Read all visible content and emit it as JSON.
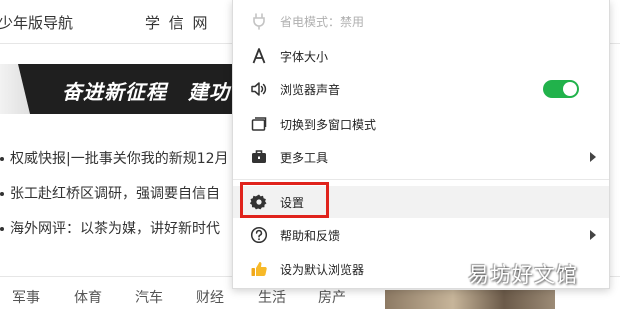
{
  "background": {
    "nav": [
      "少年版导航",
      "学 信 网"
    ],
    "banner_text": "奋进新征程　建功",
    "news": [
      "权威快报|一批事关你我的新规12月",
      "张工赴红桥区调研，强调要自信自",
      "海外网评：以茶为媒，讲好新时代"
    ],
    "categories": [
      "军事",
      "体育",
      "汽车",
      "财经",
      "生活",
      "房产"
    ]
  },
  "menu": {
    "power_saver": "省电模式：禁用",
    "font_size": "字体大小",
    "browser_sound": "浏览器声音",
    "browser_sound_enabled": true,
    "multi_window": "切换到多窗口模式",
    "more_tools": "更多工具",
    "settings": "设置",
    "help_feedback": "帮助和反馈",
    "set_default": "设为默认浏览器"
  },
  "colors": {
    "toggle_on": "#21b24b",
    "highlight": "#e0231c",
    "banner_bg": "#1f1f1f"
  },
  "watermark": "易坊好文馆"
}
